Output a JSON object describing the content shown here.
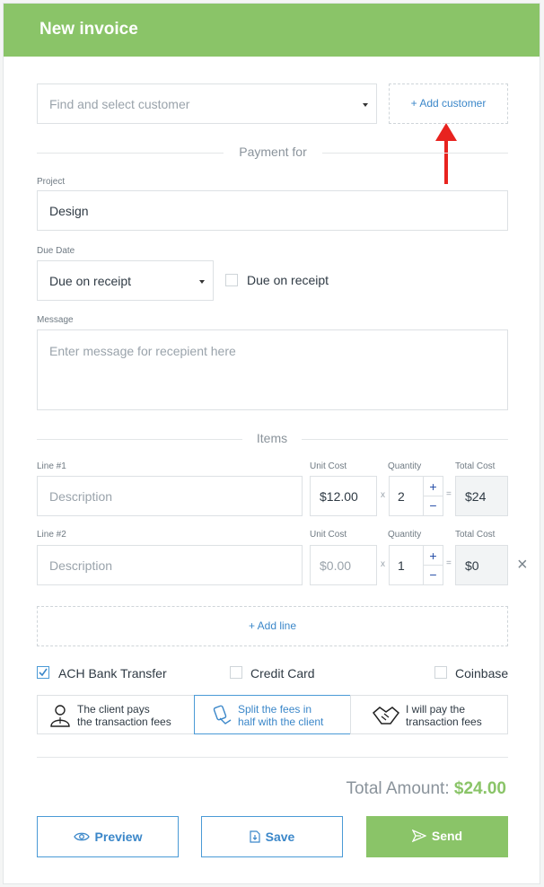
{
  "header": {
    "title": "New invoice"
  },
  "customer": {
    "placeholder": "Find and select customer",
    "add_label": "+ Add customer"
  },
  "payment_for": {
    "title": "Payment for"
  },
  "project": {
    "label": "Project",
    "value": "Design"
  },
  "due_date": {
    "label": "Due Date",
    "value": "Due on receipt",
    "checkbox_label": "Due on receipt"
  },
  "message": {
    "label": "Message",
    "placeholder": "Enter message for recepient here"
  },
  "items": {
    "title": "Items",
    "lines": [
      {
        "label": "Line #1",
        "description_placeholder": "Description",
        "unit_cost_label": "Unit Cost",
        "unit_cost": "$12.00",
        "quantity_label": "Quantity",
        "quantity": "2",
        "total_label": "Total Cost",
        "total": "$24",
        "multiply": "x",
        "equals": "="
      },
      {
        "label": "Line #2",
        "description_placeholder": "Description",
        "unit_cost_label": "Unit Cost",
        "unit_cost": "$0.00",
        "quantity_label": "Quantity",
        "quantity": "1",
        "total_label": "Total Cost",
        "total": "$0",
        "multiply": "x",
        "equals": "="
      }
    ],
    "add_line_label": "+ Add line",
    "stepper_plus": "+",
    "stepper_minus": "−",
    "remove_glyph": "×"
  },
  "payment_methods": [
    {
      "label": "ACH Bank Transfer",
      "checked": true
    },
    {
      "label": "Credit Card",
      "checked": false
    },
    {
      "label": "Coinbase",
      "checked": false
    }
  ],
  "fee_options": [
    {
      "line1": "The client pays",
      "line2": "the transaction fees",
      "icon": "person-icon"
    },
    {
      "line1": "Split the fees in",
      "line2": "half with the client",
      "icon": "hand-tag-icon",
      "selected": true
    },
    {
      "line1": "I will pay the",
      "line2": "transaction fees",
      "icon": "handshake-icon"
    }
  ],
  "total": {
    "label": "Total Amount:",
    "value": "$24.00",
    "accent": "#8ac468"
  },
  "actions": {
    "preview": "Preview",
    "save": "Save",
    "send": "Send"
  },
  "colors": {
    "brand_green": "#8ac468",
    "link_blue": "#3b87c9",
    "annotation_red": "#e8231f"
  }
}
